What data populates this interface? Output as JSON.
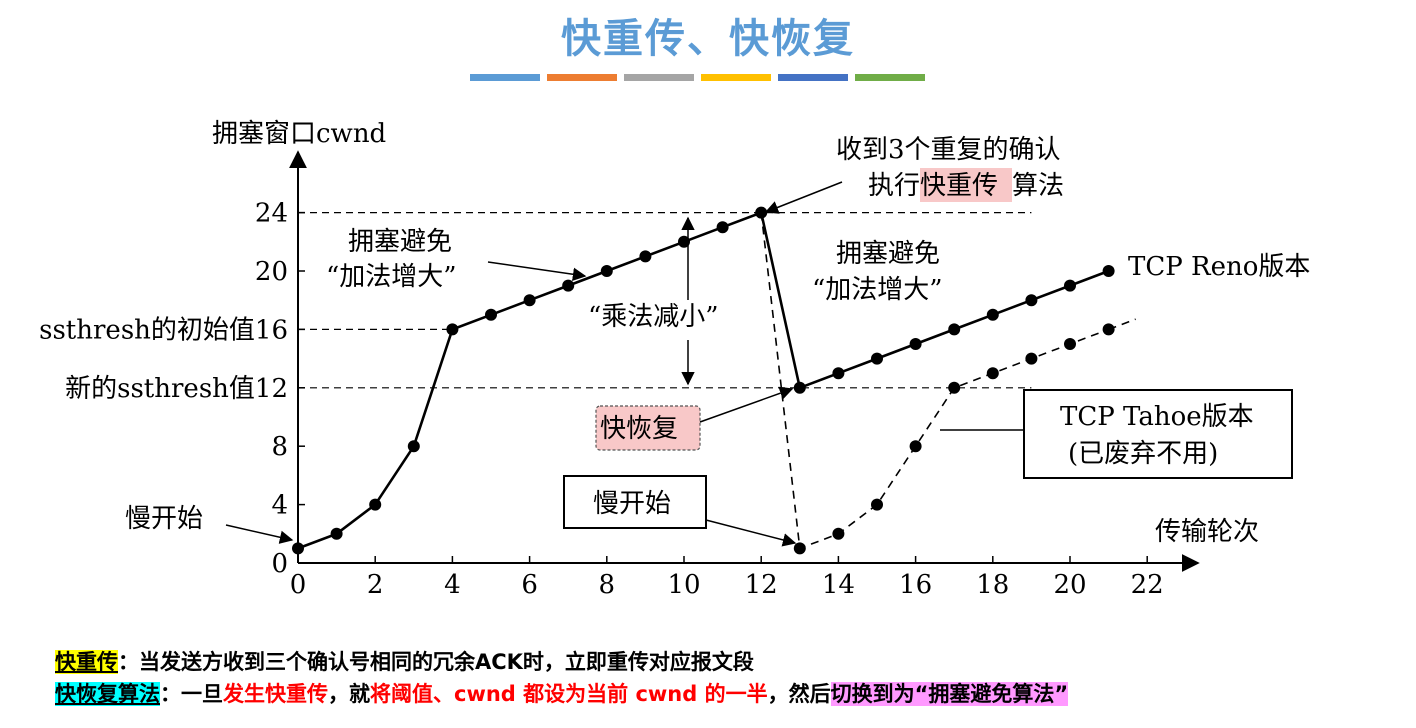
{
  "title": "快重传、快恢复",
  "title_bar_colors": [
    "#5b9bd5",
    "#ed7d31",
    "#a5a5a5",
    "#ffc000",
    "#4472c4",
    "#70ad47"
  ],
  "chart_data": {
    "type": "line",
    "ylabel": "拥塞窗口cwnd",
    "xlabel": "传输轮次",
    "xlim": [
      0,
      22
    ],
    "ylim": [
      0,
      24
    ],
    "xticks": [
      "0",
      "2",
      "4",
      "6",
      "8",
      "10",
      "12",
      "14",
      "16",
      "18",
      "20",
      "22"
    ],
    "yticks": [
      "0",
      "4",
      "8",
      "12",
      "16",
      "20",
      "24"
    ],
    "y_tick_extra_labels": {
      "16": "ssthresh的初始值",
      "12": "新的ssthresh值"
    },
    "series": [
      {
        "name": "TCP Reno版本",
        "style": "solid",
        "points": [
          [
            0,
            1
          ],
          [
            1,
            2
          ],
          [
            2,
            4
          ],
          [
            3,
            8
          ],
          [
            4,
            16
          ],
          [
            5,
            17
          ],
          [
            6,
            18
          ],
          [
            7,
            19
          ],
          [
            8,
            20
          ],
          [
            9,
            21
          ],
          [
            10,
            22
          ],
          [
            11,
            23
          ],
          [
            12,
            24
          ],
          [
            13,
            12
          ],
          [
            14,
            13
          ],
          [
            15,
            14
          ],
          [
            16,
            15
          ],
          [
            17,
            16
          ],
          [
            18,
            17
          ],
          [
            19,
            18
          ],
          [
            20,
            19
          ],
          [
            21,
            20
          ]
        ]
      },
      {
        "name": "TCP Tahoe版本",
        "style": "dashed",
        "points": [
          [
            12,
            24
          ],
          [
            13,
            1
          ],
          [
            14,
            2
          ],
          [
            15,
            4
          ],
          [
            16,
            8
          ],
          [
            17,
            12
          ],
          [
            18,
            13
          ],
          [
            19,
            14
          ],
          [
            20,
            15
          ],
          [
            21,
            16
          ]
        ]
      }
    ],
    "reference_lines": [
      24,
      16,
      12
    ],
    "annotations": {
      "slow_start_left": "慢开始",
      "ca1_line1": "拥塞避免",
      "ca1_line2": "“加法增大”",
      "mult_decrease": "“乘法减小”",
      "three_dup_line1": "收到3个重复的确认",
      "three_dup_line2_a": "执行",
      "three_dup_line2_b": "快重传",
      "three_dup_line2_c": "算法",
      "ca2_line1": "拥塞避免",
      "ca2_line2": "“加法增大”",
      "reno_label": "TCP Reno版本",
      "fast_recovery": "快恢复",
      "slow_start_box": "慢开始",
      "tahoe_line1": "TCP Tahoe版本",
      "tahoe_line2": "(已废弃不用)"
    }
  },
  "notes": {
    "line1_term": "快重传",
    "line1_text": "：当发送方收到三个确认号相同的冗余ACK时，立即重传对应报文段",
    "line2_term": "快恢复算法",
    "line2_a": "：一旦",
    "line2_b": "发生快重传",
    "line2_c": "，就",
    "line2_d": "将阈值、cwnd 都设为当前 cwnd 的一半",
    "line2_e": "，然后",
    "line2_f": "切换到为“拥塞避免算法”"
  }
}
